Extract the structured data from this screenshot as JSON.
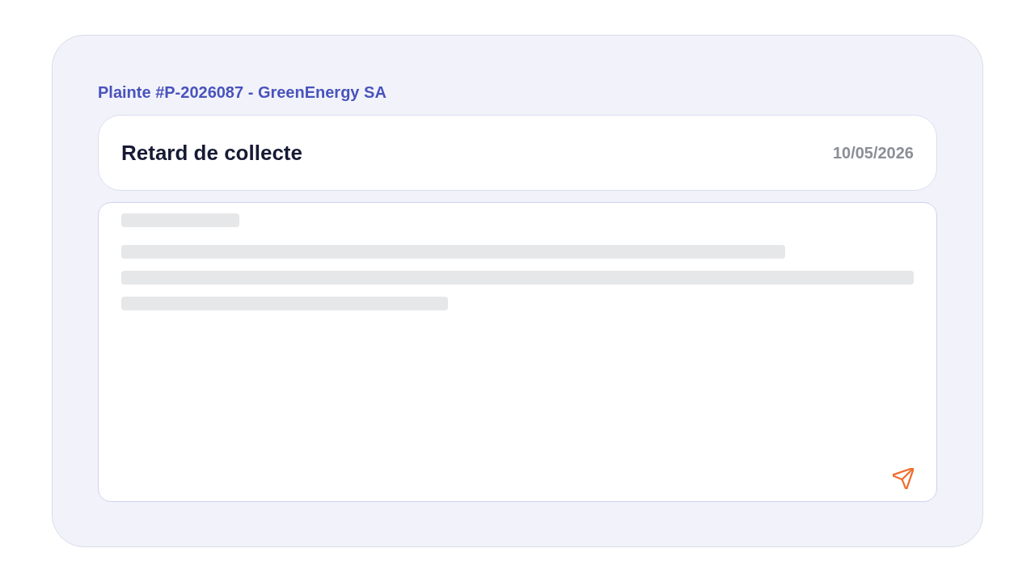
{
  "complaint": {
    "heading": "Plainte #P-2026087 - GreenEnergy SA"
  },
  "header_card": {
    "title": "Retard de collecte",
    "date": "10/05/2026"
  },
  "message_box": {
    "loading": true
  }
}
